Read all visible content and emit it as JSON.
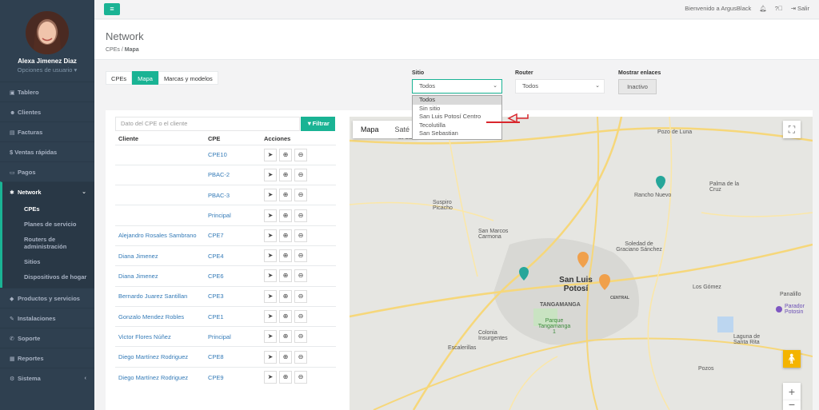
{
  "user": {
    "name": "Alexa Jimenez Diaz",
    "options": "Opciones de usuario ▾"
  },
  "nav": [
    {
      "label": "Tablero",
      "icon": "dashboard-icon"
    },
    {
      "label": "Clientes",
      "icon": "users-icon"
    },
    {
      "label": "Facturas",
      "icon": "invoice-icon"
    },
    {
      "label": "$ Ventas rápidas",
      "icon": ""
    },
    {
      "label": "Pagos",
      "icon": "payments-icon"
    },
    {
      "label": "Network",
      "icon": "network-icon"
    },
    {
      "label": "Productos y servicios",
      "icon": "products-icon"
    },
    {
      "label": "Instalaciones",
      "icon": "install-icon"
    },
    {
      "label": "Soporte",
      "icon": "support-icon"
    },
    {
      "label": "Reportes",
      "icon": "reports-icon"
    },
    {
      "label": "Sistema",
      "icon": "settings-icon"
    }
  ],
  "subnav": [
    "CPEs",
    "Planes de servicio",
    "Routers de administración",
    "Sitios",
    "Dispositivos de hogar"
  ],
  "topbar": {
    "welcome": "Bienvenido a ArgusBlack",
    "logout": "Salir"
  },
  "page": {
    "title": "Network",
    "crumb1": "CPEs",
    "crumb2": "Mapa"
  },
  "tabs": [
    "CPEs",
    "Mapa",
    "Marcas y modelos"
  ],
  "filters": {
    "sitio_label": "Sitio",
    "sitio_value": "Todos",
    "router_label": "Router",
    "router_value": "Todos",
    "enlaces_label": "Mostrar enlaces",
    "enlaces_value": "Inactivo"
  },
  "sitio_options": [
    "Todos",
    "Sin sitio",
    "San Luis Potosí Centro",
    "Tecolutilla",
    "San Sebastian"
  ],
  "search": {
    "placeholder": "Dato del CPE o el cliente",
    "button": "Filtrar"
  },
  "table": {
    "headers": [
      "Cliente",
      "CPE",
      "Acciones"
    ],
    "rows": [
      [
        "",
        "CPE10"
      ],
      [
        "",
        "PBAC-2"
      ],
      [
        "",
        "PBAC-3"
      ],
      [
        "",
        "Principal"
      ],
      [
        "Alejandro Rosales Sambrano",
        "CPE7"
      ],
      [
        "Diana Jimenez",
        "CPE4"
      ],
      [
        "Diana Jimenez",
        "CPE6"
      ],
      [
        "Bernardo Juarez Santillan",
        "CPE3"
      ],
      [
        "Gonzalo Mendez Robles",
        "CPE1"
      ],
      [
        "Victor Flores Núñez",
        "Principal"
      ],
      [
        "Diego Martínez Rodriguez",
        "CPE8"
      ],
      [
        "Diego Martínez Rodriguez",
        "CPE9"
      ]
    ]
  },
  "map": {
    "tab_map": "Mapa",
    "tab_sat": "Saté",
    "labels": [
      "Pozo de Luna",
      "Rancho Nuevo",
      "Palma de la Cruz",
      "Suspiro Picacho",
      "San Marcos Carmona",
      "Soledad de Graciano Sánchez",
      "San Luis Potosí",
      "TANGAMANGA",
      "Los Gómez",
      "Panalillo",
      "Parador Potosin",
      "Parque Tangamanga 1",
      "Colonia Insurgentes",
      "Escalerillas",
      "Laguna de Santa Rita",
      "Pozos",
      "CENTRAL",
      "de Carmona"
    ]
  }
}
